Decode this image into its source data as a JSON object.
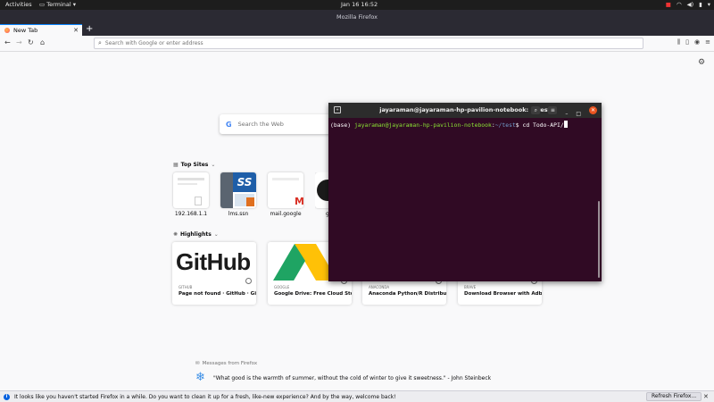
{
  "topbar": {
    "activities": "Activities",
    "app_menu": "Terminal",
    "clock": "Jan 16  16:52"
  },
  "window": {
    "title": "Mozilla Firefox"
  },
  "tabs": [
    {
      "label": "New Tab"
    }
  ],
  "navbar": {
    "url_placeholder": "Search with Google or enter address"
  },
  "newtab": {
    "search_placeholder": "Search the Web",
    "top_sites_heading": "Top Sites",
    "top_sites": [
      {
        "label": "192.168.1.1"
      },
      {
        "label": "lms.ssn"
      },
      {
        "label": "mail.google"
      },
      {
        "label": "g"
      }
    ],
    "highlights_heading": "Highlights",
    "highlights": [
      {
        "source": "GITHUB",
        "title": "Page not found · GitHub · GitHub",
        "image_text": "GitHub"
      },
      {
        "source": "GOOGLE",
        "title": "Google Drive: Free Cloud Stora..."
      },
      {
        "source": "ANACONDA",
        "title": "Anaconda Python/R Distributio..."
      },
      {
        "source": "BRAVE",
        "title": "Download Browser with Adbloc..."
      }
    ],
    "messages_heading": "Messages from Firefox",
    "quote": "\"What good is the warmth of summer, without the cold of winter to give it sweetness.\" - John Steinbeck"
  },
  "notification": {
    "text": "It looks like you haven't started Firefox in a while. Do you want to clean it up for a fresh, like-new experience? And by the way, welcome back!",
    "button": "Refresh Firefox..."
  },
  "terminal": {
    "title": "jayaraman@jayaraman-hp-pavilion-notebook: ~/test",
    "prompt_env": "(base) ",
    "prompt_user": "jayaraman@jayaraman-hp-pavilion-notebook",
    "prompt_sep": ":",
    "prompt_path": "~/test",
    "prompt_end": "$ ",
    "command": "cd Todo-API/"
  },
  "colors": {
    "terminal_bg": "#300a24",
    "prompt_green": "#8ae234",
    "prompt_blue": "#729fcf",
    "tab_accent": "#0a84ff"
  }
}
